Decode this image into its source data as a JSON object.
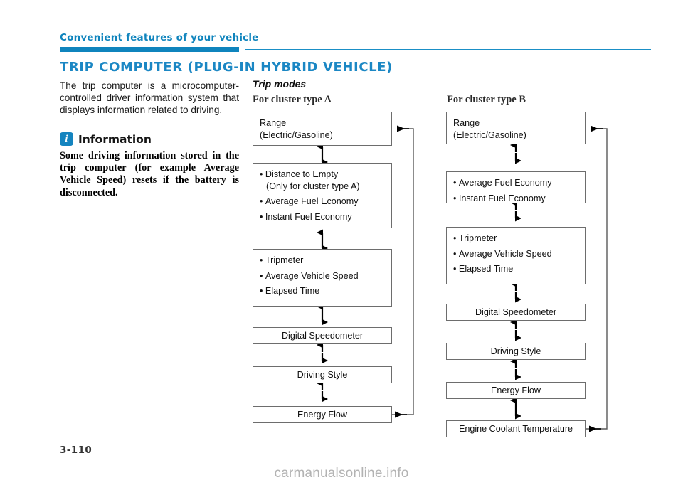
{
  "header": {
    "running_head": "Convenient features of your vehicle",
    "section_title": "TRIP COMPUTER (PLUG-IN HYBRID VEHICLE)",
    "accent_color": "#0f84bd"
  },
  "left_column": {
    "intro": "The trip computer is a microcomputer-controlled driver information system that displays information related to driving.",
    "info_icon_glyph": "i",
    "info_title": "Information",
    "info_body": "Some driving information stored in the trip computer (for example Average Vehicle Speed) resets if the battery is disconnected."
  },
  "diagram": {
    "heading": "Trip modes",
    "cluster_a": {
      "caption": "For cluster type A",
      "boxes": [
        {
          "id": "range-a",
          "type": "list",
          "lines": [
            "Range",
            "(Electric/Gasoline)"
          ]
        },
        {
          "id": "fuel-economy-a",
          "type": "bullets",
          "items": [
            {
              "text": "Distance to Empty",
              "sub": "(Only for cluster type A)"
            },
            {
              "text": "Average Fuel Economy"
            },
            {
              "text": "Instant Fuel Economy"
            }
          ]
        },
        {
          "id": "trip-a",
          "type": "bullets",
          "items": [
            {
              "text": "Tripmeter"
            },
            {
              "text": "Average Vehicle Speed"
            },
            {
              "text": "Elapsed Time"
            }
          ]
        },
        {
          "id": "digital-speedometer-a",
          "type": "single",
          "label": "Digital Speedometer"
        },
        {
          "id": "driving-style-a",
          "type": "single",
          "label": "Driving Style"
        },
        {
          "id": "energy-flow-a",
          "type": "single",
          "label": "Energy Flow"
        }
      ]
    },
    "cluster_b": {
      "caption": "For cluster type B",
      "boxes": [
        {
          "id": "range-b",
          "type": "list",
          "lines": [
            "Range",
            "(Electric/Gasoline)"
          ]
        },
        {
          "id": "fuel-economy-b",
          "type": "bullets",
          "items": [
            {
              "text": "Average Fuel Economy"
            },
            {
              "text": "Instant Fuel Economy"
            }
          ]
        },
        {
          "id": "trip-b",
          "type": "bullets",
          "items": [
            {
              "text": "Tripmeter"
            },
            {
              "text": "Average Vehicle Speed"
            },
            {
              "text": "Elapsed Time"
            }
          ]
        },
        {
          "id": "digital-speedometer-b",
          "type": "single",
          "label": "Digital Speedometer"
        },
        {
          "id": "driving-style-b",
          "type": "single",
          "label": "Driving Style"
        },
        {
          "id": "energy-flow-b",
          "type": "single",
          "label": "Energy Flow"
        },
        {
          "id": "engine-coolant-b",
          "type": "single",
          "label": "Engine Coolant Temperature"
        }
      ]
    }
  },
  "footer": {
    "page_number": "3-110",
    "watermark": "carmanualsonline.info"
  }
}
